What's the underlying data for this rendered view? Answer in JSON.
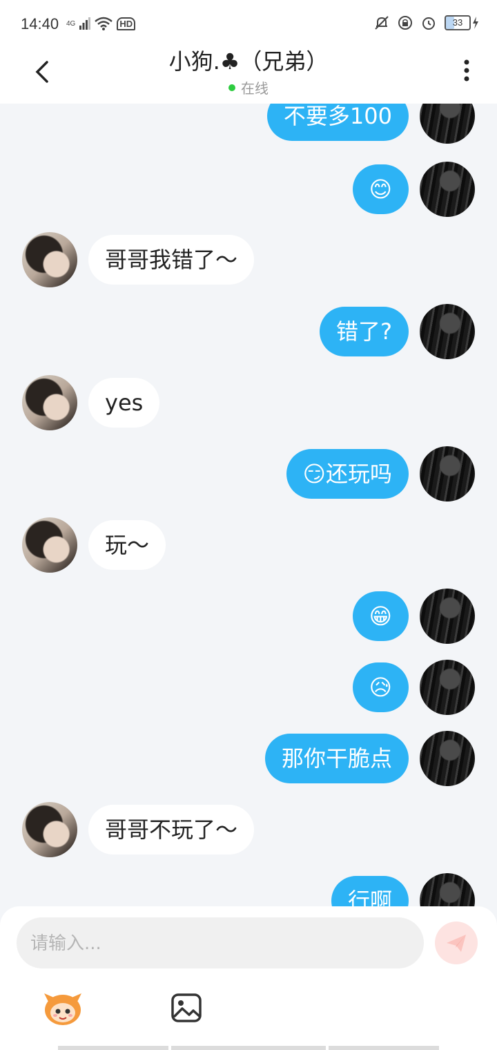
{
  "status_bar": {
    "time": "14:40",
    "network": "4G",
    "hd": "HD",
    "battery": "33"
  },
  "header": {
    "title": "小狗.♣（兄弟）",
    "status": "在线",
    "online_color": "#2ecc40",
    "icons": {
      "back": "chevron-left-icon",
      "more": "more-vertical-icon"
    }
  },
  "colors": {
    "my_bubble": "#2db3f5",
    "their_bubble": "#ffffff",
    "background": "#f3f5f8"
  },
  "messages": [
    {
      "side": "me",
      "text": "不要多100"
    },
    {
      "side": "me",
      "text": "😊"
    },
    {
      "side": "other",
      "text": "哥哥我错了～"
    },
    {
      "side": "me",
      "text": "错了?"
    },
    {
      "side": "other",
      "text": "yes"
    },
    {
      "side": "me",
      "text": "😏还玩吗"
    },
    {
      "side": "other",
      "text": "玩～"
    },
    {
      "side": "me",
      "text": "😁"
    },
    {
      "side": "me",
      "text": "😥"
    },
    {
      "side": "me",
      "text": "那你干脆点"
    },
    {
      "side": "other",
      "text": "哥哥不玩了～"
    },
    {
      "side": "me",
      "text": "行啊"
    }
  ],
  "composer": {
    "placeholder": "请输入...",
    "icons": {
      "send": "send-icon",
      "mascot": "mascot-icon",
      "image": "image-icon"
    }
  }
}
